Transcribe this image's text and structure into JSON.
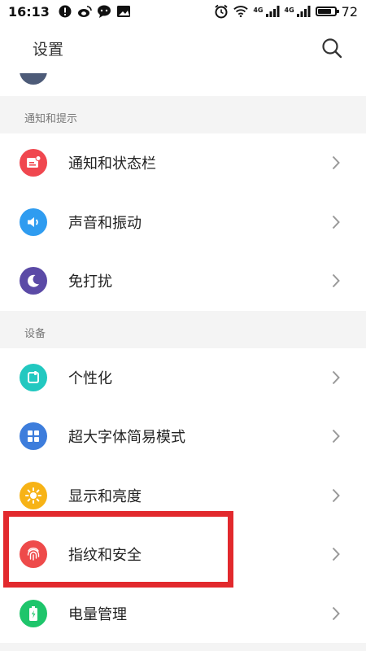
{
  "status_bar": {
    "time": "16:13",
    "network_label_1": "4G",
    "network_label_2": "4G",
    "battery_level": "72"
  },
  "header": {
    "title": "设置"
  },
  "sections": [
    {
      "title": "通知和提示",
      "items": [
        {
          "label": "通知和状态栏",
          "icon": "notification-icon",
          "color": "#f0474f"
        },
        {
          "label": "声音和振动",
          "icon": "sound-icon",
          "color": "#2f9cf0"
        },
        {
          "label": "免打扰",
          "icon": "moon-icon",
          "color": "#5b4aa6"
        }
      ]
    },
    {
      "title": "设备",
      "items": [
        {
          "label": "个性化",
          "icon": "personalize-icon",
          "color": "#22c8c0"
        },
        {
          "label": "超大字体简易模式",
          "icon": "grid-icon",
          "color": "#3d7ddc"
        },
        {
          "label": "显示和亮度",
          "icon": "brightness-icon",
          "color": "#f7b316"
        },
        {
          "label": "指纹和安全",
          "icon": "fingerprint-icon",
          "color": "#ee4a4a"
        },
        {
          "label": "电量管理",
          "icon": "battery-icon",
          "color": "#1ec56b"
        }
      ]
    }
  ]
}
